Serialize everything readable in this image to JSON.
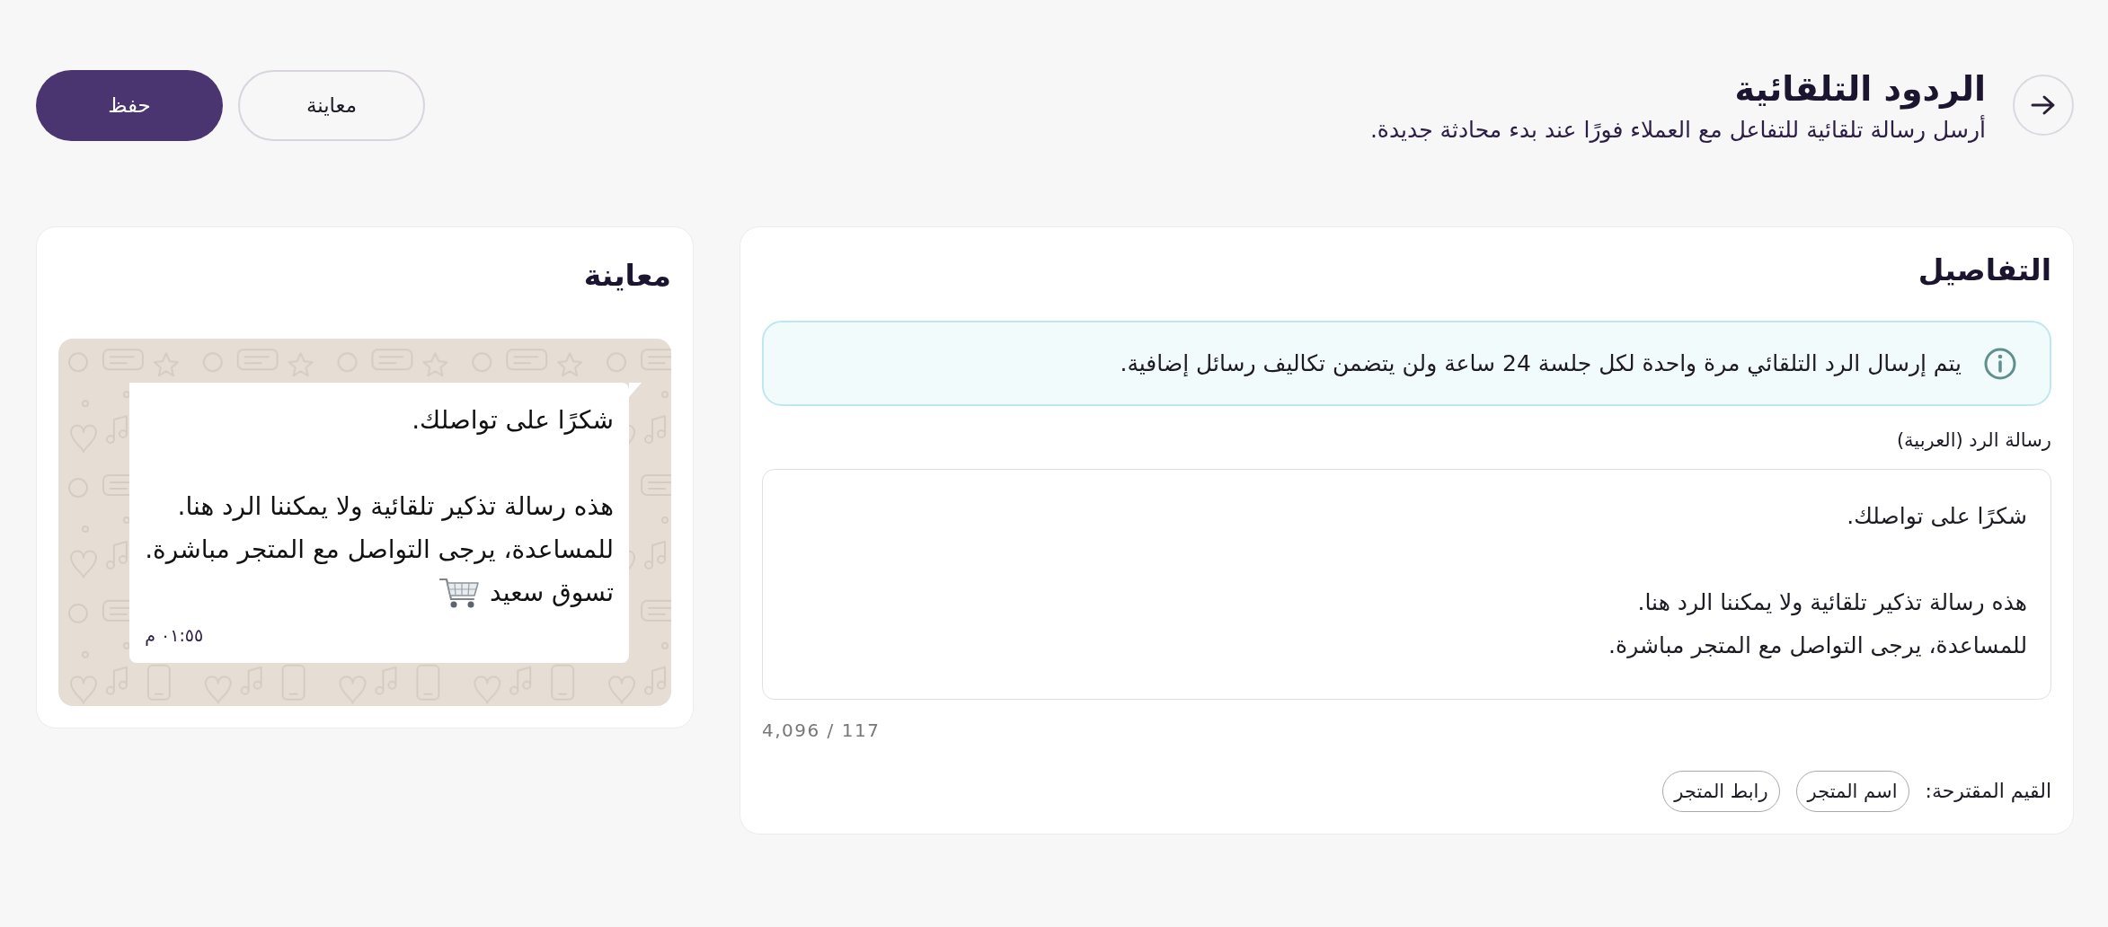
{
  "header": {
    "title": "الردود التلقائية",
    "subtitle": "أرسل رسالة تلقائية للتفاعل مع العملاء فورًا عند بدء محادثة جديدة.",
    "actions": [
      {
        "label": "معاينة",
        "kind": "secondary"
      },
      {
        "label": "حفظ",
        "kind": "primary"
      }
    ]
  },
  "details": {
    "title": "التفاصيل",
    "notice": "يتم إرسال الرد التلقائي مرة واحدة لكل جلسة 24 ساعة ولن يتضمن تكاليف رسائل إضافية.",
    "field_label": "رسالة الرد (العربية)",
    "message": "شكرًا على تواصلك.\n\nهذه رسالة تذكير تلقائية ولا يمكننا الرد هنا.\nللمساعدة، يرجى التواصل مع المتجر مباشرة.",
    "counter": "117 / 4,096",
    "suggestions_label": "القيم المقترحة:",
    "suggestions": [
      "اسم المتجر",
      "رابط المتجر"
    ]
  },
  "preview": {
    "title": "معاينة",
    "bubble": {
      "text": "شكرًا على تواصلك.\n\nهذه رسالة تذكير تلقائية ولا يمكننا الرد هنا.\nللمساعدة، يرجى التواصل مع المتجر مباشرة.",
      "last_line": "تسوق سعيد",
      "time": "٠١:٥٥ م"
    }
  }
}
